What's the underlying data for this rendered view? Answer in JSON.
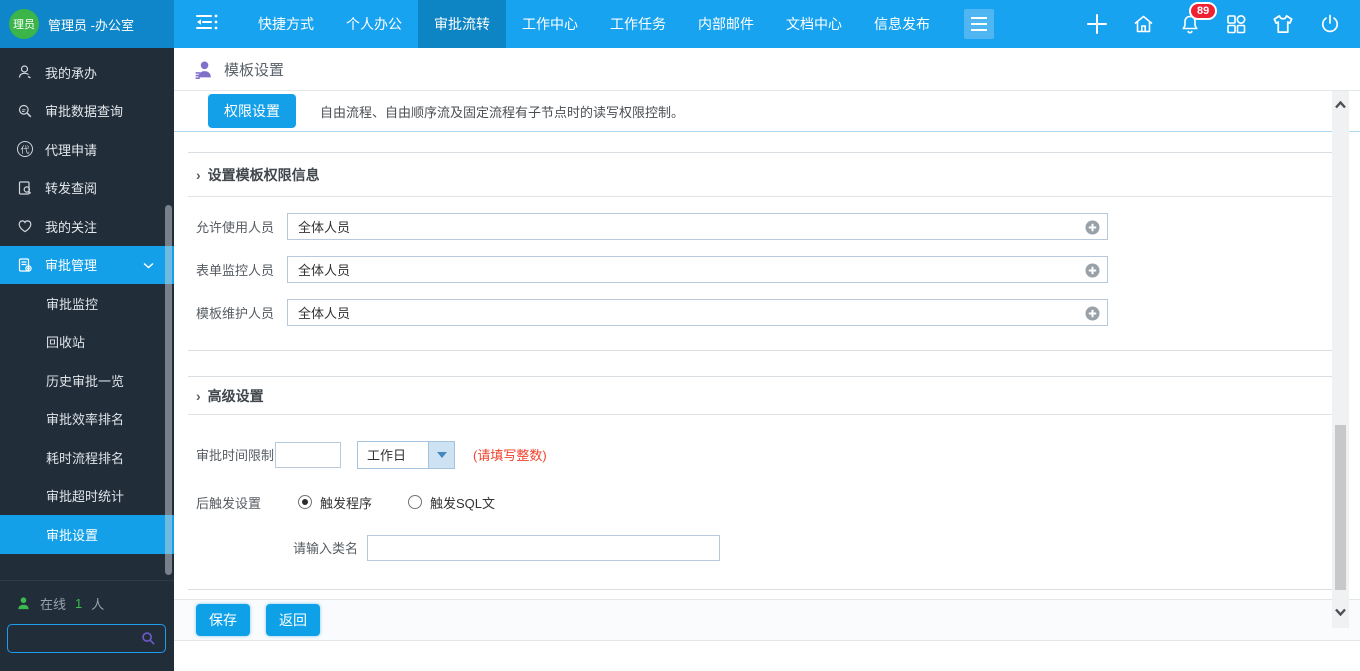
{
  "topbar": {
    "avatar_text": "理员",
    "user_name": "管理员 -办公室",
    "nav": [
      {
        "label": "快捷方式"
      },
      {
        "label": "个人办公"
      },
      {
        "label": "审批流转"
      },
      {
        "label": "工作中心"
      },
      {
        "label": "工作任务"
      },
      {
        "label": "内部邮件"
      },
      {
        "label": "文档中心"
      },
      {
        "label": "信息发布"
      }
    ],
    "active_nav": "审批流转",
    "notification_count": "89"
  },
  "sidebar": {
    "items": [
      {
        "label": "我的承办",
        "icon": "person-icon"
      },
      {
        "label": "审批数据查询",
        "icon": "search-icon"
      },
      {
        "label": "代理申请",
        "icon": "agent-icon",
        "icon_char": "代"
      },
      {
        "label": "转发查阅",
        "icon": "doc-search-icon"
      },
      {
        "label": "我的关注",
        "icon": "heart-icon"
      },
      {
        "label": "审批管理",
        "icon": "doc-gear-icon",
        "expanded": true,
        "active": true
      }
    ],
    "subitems": [
      {
        "label": "审批监控"
      },
      {
        "label": "回收站"
      },
      {
        "label": "历史审批一览"
      },
      {
        "label": "审批效率排名"
      },
      {
        "label": "耗时流程排名"
      },
      {
        "label": "审批超时统计"
      },
      {
        "label": "审批设置",
        "active": true
      }
    ],
    "online_label": "在线",
    "online_count": "1",
    "online_unit": "人"
  },
  "main": {
    "page_title": "模板设置",
    "marker": "›",
    "tab_label": "权限设置",
    "tab_desc": "自由流程、自由顺序流及固定流程有子节点时的读写权限控制。",
    "perm_section": {
      "title": "设置模板权限信息",
      "fields": [
        {
          "label": "允许使用人员",
          "value": "全体人员"
        },
        {
          "label": "表单监控人员",
          "value": "全体人员"
        },
        {
          "label": "模板维护人员",
          "value": "全体人员"
        }
      ]
    },
    "adv_section": {
      "title": "高级设置",
      "time_label": "审批时间限制",
      "time_value": "",
      "time_unit": "工作日",
      "time_note": "(请填写整数)",
      "trigger_label": "后触发设置",
      "trigger_options": [
        {
          "label": "触发程序",
          "selected": true
        },
        {
          "label": "触发SQL文",
          "selected": false
        }
      ],
      "class_label": "请输入类名",
      "class_value": ""
    },
    "footer": {
      "save": "保存",
      "back": "返回"
    }
  },
  "colors": {
    "accent": "#14a0e8",
    "topbar": "#17a3ef",
    "topbar_dark": "#0e86c9",
    "nav_active": "#0d84c4",
    "sidebar_bg": "#222d3a",
    "badge_red": "#ee2233",
    "note_red": "#f0422d",
    "online_green": "#3cb94f",
    "title_purple": "#8070ca"
  }
}
